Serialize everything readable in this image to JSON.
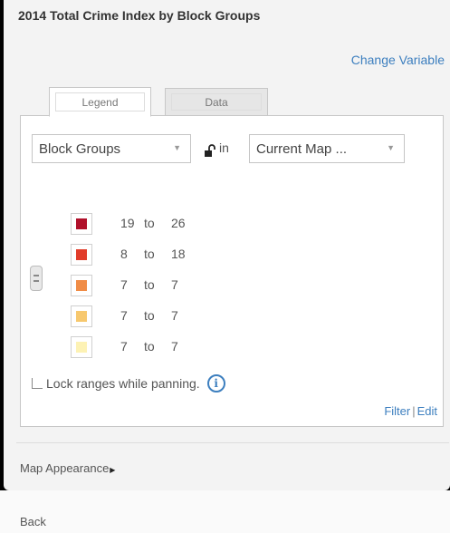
{
  "panel": {
    "title": "2014 Total Crime Index by Block Groups",
    "change_variable": "Change Variable"
  },
  "tabs": [
    {
      "label": "Legend",
      "active": true
    },
    {
      "label": "Data",
      "active": false
    }
  ],
  "legend": {
    "geography_select": "Block Groups",
    "in_label": "in",
    "extent_select": "Current Map ...",
    "lock_icon": "padlock-unlocked-icon",
    "rows": [
      {
        "low": "19",
        "to": "to",
        "high": "26",
        "color": "#b0102a"
      },
      {
        "low": "8",
        "to": "to",
        "high": "18",
        "color": "#e13c2a"
      },
      {
        "low": "7",
        "to": "to",
        "high": "7",
        "color": "#f08c46"
      },
      {
        "low": "7",
        "to": "to",
        "high": "7",
        "color": "#f7c86e"
      },
      {
        "low": "7",
        "to": "to",
        "high": "7",
        "color": "#fdf2b4"
      }
    ],
    "lock_ranges_label": "Lock ranges while panning.",
    "info_icon": "i",
    "filter_label": "Filter",
    "separator": "|",
    "edit_label": "Edit"
  },
  "map_appearance": "Map Appearance",
  "back": "Back",
  "colors": {
    "accent": "#3d7fbf"
  }
}
